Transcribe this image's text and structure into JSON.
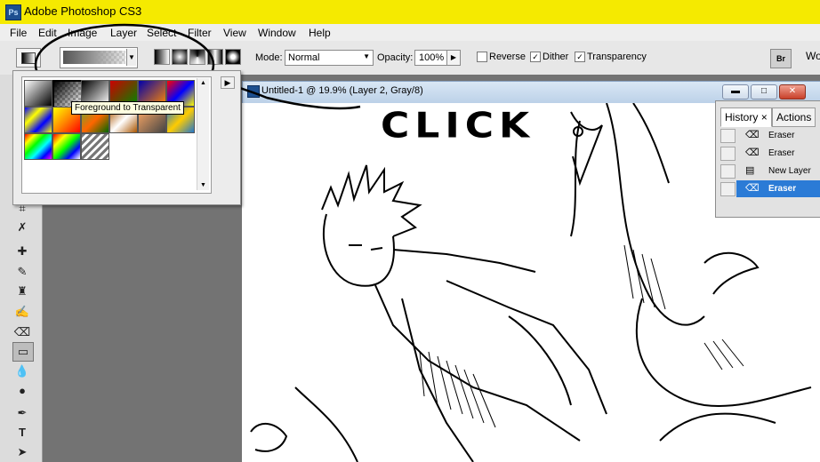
{
  "app": {
    "title": "Adobe Photoshop CS3",
    "logo_text": "Ps"
  },
  "menu": [
    "File",
    "Edit",
    "Image",
    "Layer",
    "Select",
    "Filter",
    "View",
    "Window",
    "Help"
  ],
  "options": {
    "mode_label": "Mode:",
    "mode_value": "Normal",
    "opacity_label": "Opacity:",
    "opacity_value": "100%",
    "reverse_label": "Reverse",
    "dither_label": "Dither",
    "transparency_label": "Transparency",
    "reverse_checked": false,
    "dither_checked": true,
    "transparency_checked": true,
    "workspace_label": "Wo"
  },
  "gradient_picker": {
    "tooltip": "Foreground to Transparent",
    "swatch_count": 17
  },
  "document": {
    "title": "Untitled-1 @ 19.9% (Layer 2, Gray/8)",
    "min": "▬",
    "max": "□",
    "close": "✕"
  },
  "annotation": {
    "text": "CLICK",
    "color": "#000000"
  },
  "history_panel": {
    "tabs": [
      "History",
      "Actions"
    ],
    "close_glyph": "×",
    "items": [
      {
        "label": "Eraser",
        "icon": "eraser-icon",
        "selected": false
      },
      {
        "label": "Eraser",
        "icon": "eraser-icon",
        "selected": false
      },
      {
        "label": "New Layer",
        "icon": "new-layer-icon",
        "selected": false
      },
      {
        "label": "Eraser",
        "icon": "eraser-icon",
        "selected": true
      }
    ]
  },
  "colors": {
    "title_bar": "#f5ea00",
    "selected_row": "#2b7bd6",
    "tooltip_bg": "#ffffe1"
  }
}
